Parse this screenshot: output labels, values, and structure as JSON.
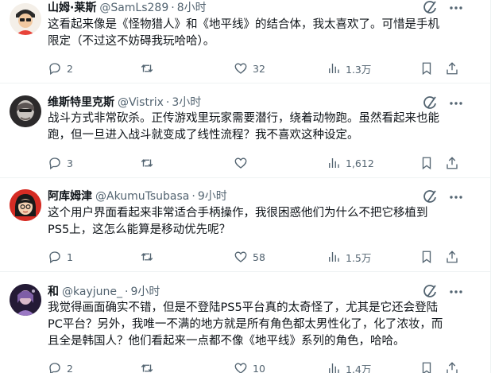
{
  "tweets": [
    {
      "name": "山姆·莱斯",
      "handle": "@SamLs289",
      "dot": "·",
      "time": "8小时",
      "lines": [
        "这看起来像是《怪物猎人》和《地平线》的结合体，我太喜欢了。可惜是手机",
        "限定（不过这不妨碍我玩哈哈）。"
      ],
      "replies": "2",
      "retweets": "",
      "likes": "32",
      "views": "1.3万",
      "avatar_color": "#e8443a"
    },
    {
      "name": "维斯特里克斯",
      "handle": "@Vistrix",
      "dot": "·",
      "time": "3小时",
      "lines": [
        "战斗方式非常砍杀。正传游戏里玩家需要潜行，绕着动物跑。虽然看起来也能",
        "跑，但一旦进入战斗就变成了线性流程？我不喜欢这种设定。"
      ],
      "replies": "3",
      "retweets": "",
      "likes": "",
      "views": "1,612",
      "avatar_color": "#3d3a3c"
    },
    {
      "name": "阿库姆津",
      "handle": "@AkumuTsubasa",
      "dot": "·",
      "time": "9小时",
      "lines": [
        "这个用户界面看起来非常适合手柄操作，我很困惑他们为什么不把它移植到",
        "PS5上，这怎么能算是移动优先呢？"
      ],
      "replies": "1",
      "retweets": "",
      "likes": "58",
      "views": "1.5万",
      "avatar_color": "#d62c24"
    },
    {
      "name": "和",
      "handle": "@kayjune_",
      "dot": "·",
      "time": "9小时",
      "lines": [
        "我觉得画面确实不错，但是不登陆PS5平台真的太奇怪了，尤其是它还会登陆",
        "PC平台？另外，我唯一不满的地方就是所有角色都太男性化了，化了浓妆，而",
        "且全是韩国人？他们看起来一点都不像《地平线》系列的角色，哈哈。"
      ],
      "replies": "2",
      "retweets": "",
      "likes": "10",
      "views": "1.4万",
      "avatar_color": "#5a3f7a"
    }
  ],
  "colors": {
    "text_primary": "#0f1419",
    "text_secondary": "#536471",
    "divider": "#eff3f4"
  }
}
